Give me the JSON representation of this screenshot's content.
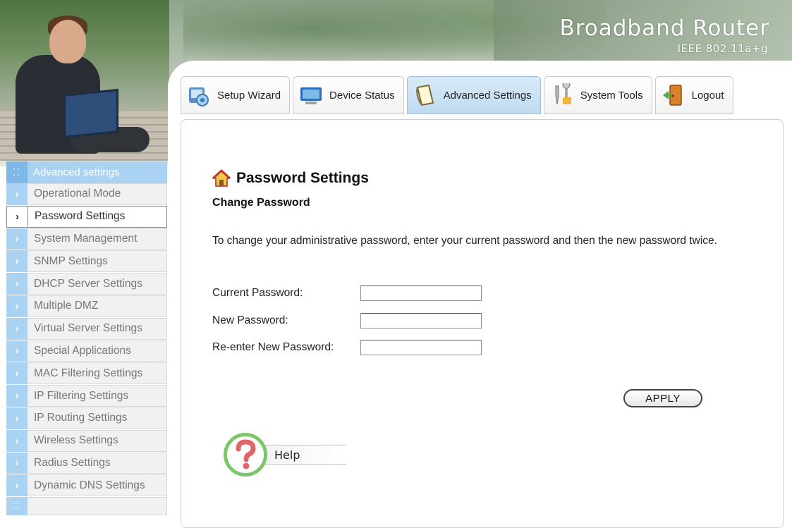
{
  "header": {
    "brand_title": "Broadband Router",
    "brand_subtitle": "IEEE 802.11a+g"
  },
  "tabs": [
    {
      "label": "Setup Wizard",
      "icon": "setup-wizard-icon",
      "active": false
    },
    {
      "label": "Device Status",
      "icon": "device-status-icon",
      "active": false
    },
    {
      "label": "Advanced Settings",
      "icon": "advanced-settings-icon",
      "active": true
    },
    {
      "label": "System Tools",
      "icon": "system-tools-icon",
      "active": false
    },
    {
      "label": "Logout",
      "icon": "logout-icon",
      "active": false
    }
  ],
  "sidebar": {
    "header": "Advanced settings",
    "items": [
      {
        "label": "Operational Mode"
      },
      {
        "label": "Password Settings",
        "current": true
      },
      {
        "label": "System Management"
      },
      {
        "label": "SNMP Settings"
      },
      {
        "label": "DHCP Server Settings"
      },
      {
        "label": "Multiple DMZ"
      },
      {
        "label": "Virtual Server Settings"
      },
      {
        "label": "Special Applications"
      },
      {
        "label": "MAC Filtering Settings"
      },
      {
        "label": "IP Filtering Settings"
      },
      {
        "label": "IP Routing Settings"
      },
      {
        "label": "Wireless Settings"
      },
      {
        "label": "Radius Settings"
      },
      {
        "label": "Dynamic DNS Settings"
      }
    ]
  },
  "main": {
    "page_title": "Password Settings",
    "section_title": "Change Password",
    "description": "To change your administrative password, enter your current password and then the new password twice.",
    "fields": {
      "current_password": {
        "label": "Current Password:",
        "value": ""
      },
      "new_password": {
        "label": "New Password:",
        "value": ""
      },
      "reenter_password": {
        "label": "Re-enter New Password:",
        "value": ""
      }
    },
    "apply_label": "APPLY",
    "help_label": "Help"
  },
  "colors": {
    "sidebar_accent": "#a9d2f3",
    "active_tab": "#bfdaf0",
    "help_ring": "#7cc66a",
    "help_question": "#e0646a"
  }
}
